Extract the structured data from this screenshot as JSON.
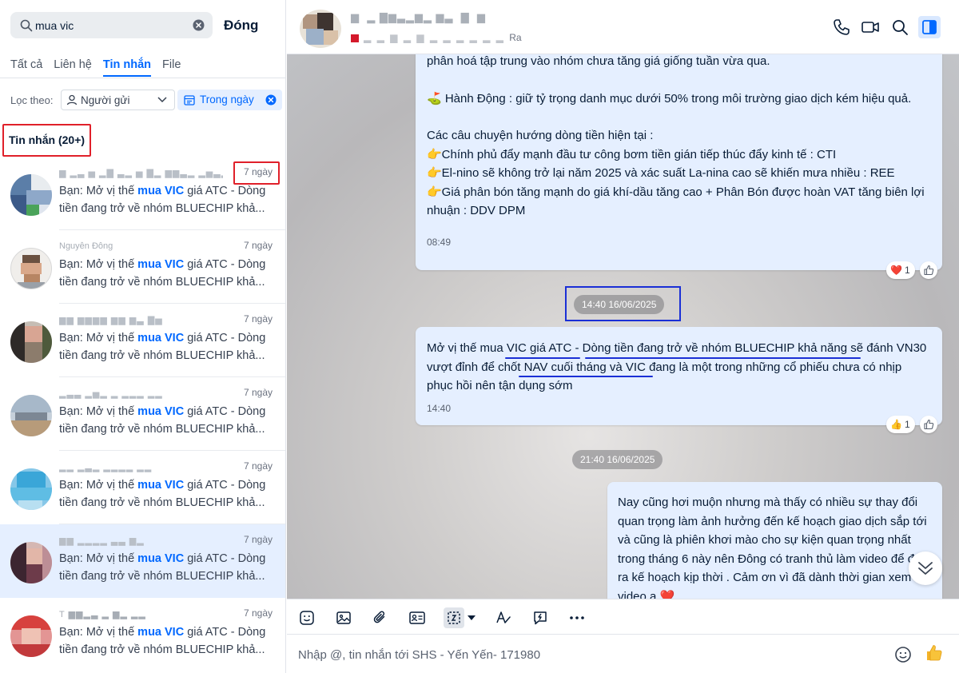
{
  "search": {
    "value": "mua vic",
    "close_label": "Đóng"
  },
  "tabs": [
    {
      "label": "Tất cả",
      "active": false
    },
    {
      "label": "Liên hệ",
      "active": false
    },
    {
      "label": "Tin nhắn",
      "active": true
    },
    {
      "label": "File",
      "active": false
    }
  ],
  "filter": {
    "label": "Lọc theo:",
    "sender": "Người gửi",
    "date": "Trong ngày"
  },
  "section_title": "Tin nhắn (20+)",
  "conversations": [
    {
      "time": "7 ngày",
      "prefix": "Bạn: Mở vị thế ",
      "keyword": "mua VIC",
      "rest": " giá ATC - Dòng tiền đang trở về nhóm BLUECHIP khả..."
    },
    {
      "time": "7 ngày",
      "name": "Nguyễn Đông",
      "prefix": "Bạn: Mở vị thế ",
      "keyword": "mua VIC",
      "rest": " giá ATC - Dòng tiền đang trở về nhóm BLUECHIP khả..."
    },
    {
      "time": "7 ngày",
      "prefix": "Bạn: Mở vị thế ",
      "keyword": "mua VIC",
      "rest": " giá ATC - Dòng tiền đang trở về nhóm BLUECHIP khả..."
    },
    {
      "time": "7 ngày",
      "prefix": "Bạn: Mở vị thế ",
      "keyword": "mua VIC",
      "rest": " giá ATC - Dòng tiền đang trở về nhóm BLUECHIP khả..."
    },
    {
      "time": "7 ngày",
      "prefix": "Bạn: Mở vị thế ",
      "keyword": "mua VIC",
      "rest": " giá ATC - Dòng tiền đang trở về nhóm BLUECHIP khả..."
    },
    {
      "time": "7 ngày",
      "prefix": "Bạn: Mở vị thế ",
      "keyword": "mua VIC",
      "rest": " giá ATC - Dòng tiền đang trở về nhóm BLUECHIP khả...",
      "selected": true
    },
    {
      "time": "7 ngày",
      "name": "T",
      "prefix": "Bạn: Mở vị thế ",
      "keyword": "mua VIC",
      "rest": " giá ATC - Dòng tiền đang trở về nhóm BLUECHIP khả..."
    }
  ],
  "chat_header": {
    "status_suffix": "Ra"
  },
  "messages": {
    "m1": {
      "l1": "phân hoá tập trung vào nhóm chưa tăng giá giống tuần vừa qua.",
      "l2": "⛳ Hành Động : giữ tỷ trọng danh mục dưới 50% trong môi trường giao dịch kém hiệu quả.",
      "l3": "Các câu chuyện hướng dòng tiền hiện tại :",
      "l4": "👉Chính phủ đẩy mạnh đầu tư công bơm tiền gián tiếp thúc đẩy kinh tế : CTI",
      "l5": "👉El-nino sẽ không trở lại năm 2025 và xác suất La-nina cao sẽ khiến mưa nhiều : REE",
      "l6": "👉Giá phân bón tăng mạnh do giá khí-dầu tăng cao + Phân Bón được hoàn VAT tăng biên lợi nhuận : DDV DPM",
      "time": "08:49",
      "reaction": "❤️",
      "reaction_count": "1"
    },
    "stamp1": "14:40 16/06/2025",
    "m2": {
      "text": "Mở vị thế mua VIC giá ATC - Dòng tiền đang trở về nhóm BLUECHIP khả năng sẽ đánh VN30 vượt đỉnh để chốt NAV cuối tháng và VIC đang là một trong những cổ phiếu chưa có nhịp phục hồi nên tận dụng sớm",
      "time": "14:40",
      "reaction": "👍",
      "reaction_count": "1"
    },
    "stamp2": "21:40 16/06/2025",
    "m3": {
      "text": "Nay cũng hơi muộn nhưng mà thấy có nhiều sự thay đổi quan trọng làm ảnh hưởng đến kế hoạch giao dịch sắp tới và cũng là phiên khơi mào cho sự kiện quan trọng nhất trong tháng 6 này nên Đông có tranh thủ làm video để đưa ra kế hoạch kịp thời . Cảm ơn vì đã dành thời gian xem video ạ ❤️"
    }
  },
  "composer": {
    "placeholder": "Nhập @, tin nhắn tới SHS - Yến Yến- 171980"
  }
}
